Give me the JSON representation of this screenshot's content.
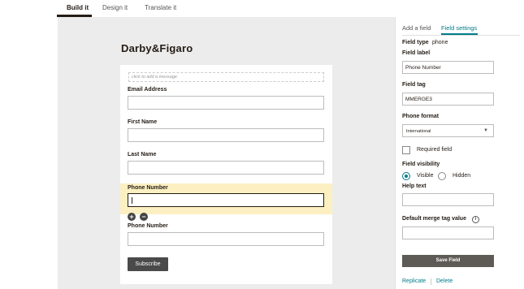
{
  "top_tabs": [
    {
      "label": "Build it",
      "active": true
    },
    {
      "label": "Design it",
      "active": false
    },
    {
      "label": "Translate it",
      "active": false
    }
  ],
  "form": {
    "title": "Darby&Figaro",
    "message_placeholder": "click to add a message",
    "fields": [
      {
        "label": "Email Address",
        "value": ""
      },
      {
        "label": "First Name",
        "value": ""
      },
      {
        "label": "Last Name",
        "value": ""
      },
      {
        "label": "Phone Number",
        "value": "",
        "selected": true
      },
      {
        "label": "Phone Number",
        "value": ""
      }
    ],
    "add_icon": "plus-circle-icon",
    "remove_icon": "minus-circle-icon",
    "subscribe_label": "Subscribe"
  },
  "panel": {
    "tabs": [
      {
        "label": "Add a field",
        "active": false
      },
      {
        "label": "Field settings",
        "active": true
      }
    ],
    "field_type_label": "Field type",
    "field_type_value": "phone",
    "field_label_label": "Field label",
    "field_label_value": "Phone Number",
    "field_tag_label": "Field tag",
    "field_tag_value": "MMERGE3",
    "phone_format_label": "Phone format",
    "phone_format_value": "International",
    "required_label": "Required field",
    "required_checked": false,
    "visibility_label": "Field visibility",
    "visibility_options": [
      {
        "label": "Visible",
        "selected": true
      },
      {
        "label": "Hidden",
        "selected": false
      }
    ],
    "help_text_label": "Help text",
    "help_text_value": "",
    "default_merge_label": "Default merge tag value",
    "default_merge_value": "",
    "save_label": "Save Field",
    "replicate_label": "Replicate",
    "delete_label": "Delete"
  },
  "colors": {
    "accent": "#007c89",
    "highlight": "#fcefc1",
    "canvas": "#ececec",
    "button": "#4a4a4a"
  }
}
